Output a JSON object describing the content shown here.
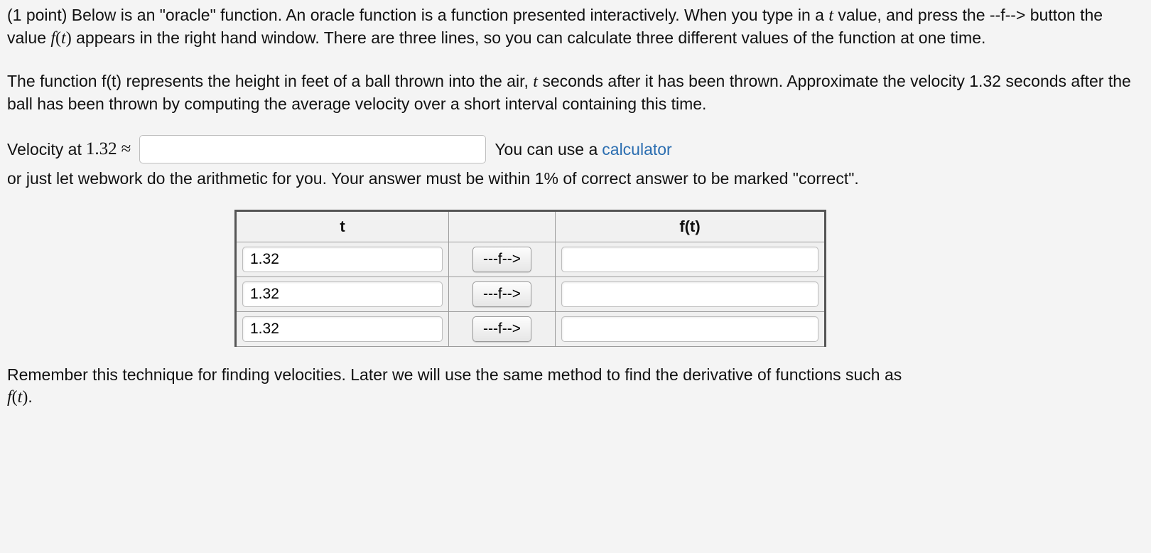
{
  "intro": {
    "point_label": "(1 point) ",
    "s1a": "Below is an \"oracle\" function. An oracle function is a function presented interactively. When you type in a ",
    "var_t": "t",
    "s1b": " value, and press the --f--> button the value ",
    "s1_fn": "f(t)",
    "s1c": " appears in the right hand window. There are three lines, so you can calculate three different values of the function at one time."
  },
  "para2": {
    "a": "The function f(t) represents the height in feet of a ball thrown into the air, ",
    "var_t": "t",
    "b": " seconds after it has been thrown. Approximate the velocity 1.32 seconds after the ball has been thrown by computing the average velocity over a short interval containing this time."
  },
  "answer": {
    "label_a": "Velocity at ",
    "value_num": "1.32",
    "approx": " ≈ ",
    "input_value": "",
    "after_a": " You can use a ",
    "calc_link": "calculator",
    "after_b": " or just let webwork do the arithmetic for you. Your answer must be within 1% of correct answer to be marked \"correct\"."
  },
  "oracle": {
    "head_t": "t",
    "head_ft": "f(t)",
    "button_label": "---f-->",
    "rows": [
      {
        "t": "1.32",
        "out": ""
      },
      {
        "t": "1.32",
        "out": ""
      },
      {
        "t": "1.32",
        "out": ""
      }
    ]
  },
  "footer": {
    "a": "Remember this technique for finding velocities. Later we will use the same method to find the derivative of functions such as ",
    "fn": "f(t)",
    "b": "."
  }
}
